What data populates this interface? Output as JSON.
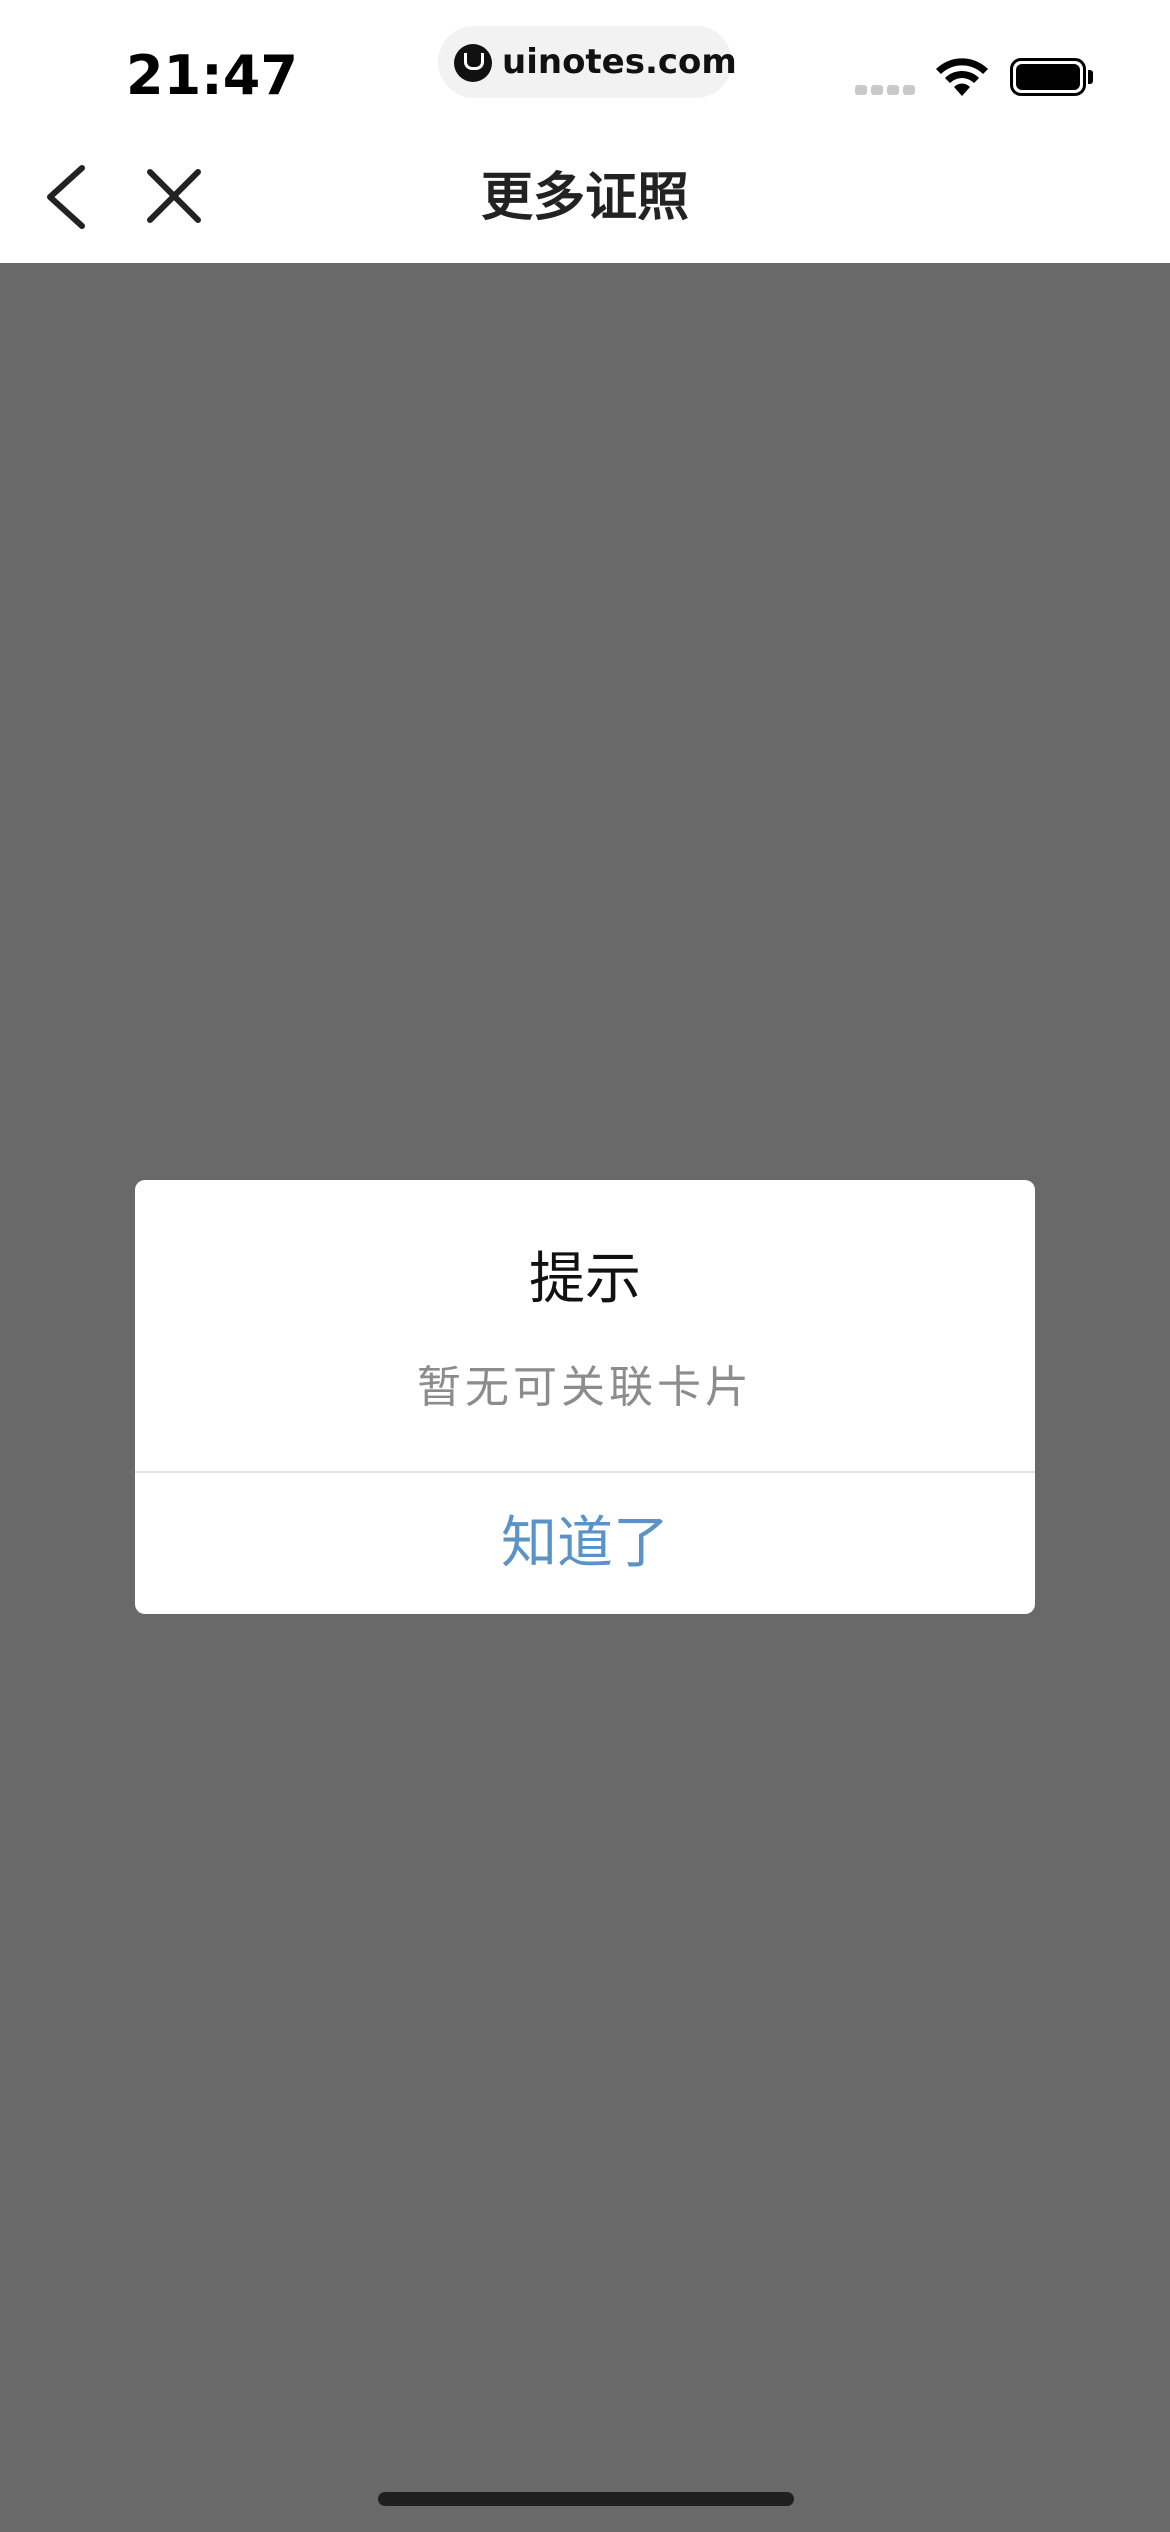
{
  "status_bar": {
    "time": "21:47",
    "watermark": "uinotes.com",
    "icons": [
      "signal-icon",
      "wifi-icon",
      "battery-icon"
    ]
  },
  "nav": {
    "title": "更多证照",
    "back_icon": "chevron-left-icon",
    "close_icon": "close-icon"
  },
  "dialog": {
    "title": "提示",
    "message": "暂无可关联卡片",
    "confirm_label": "知道了"
  },
  "colors": {
    "overlay": "#696969",
    "dialog_button": "#5a93c8",
    "message_text": "#8c8c8c",
    "title_text": "#111111"
  }
}
